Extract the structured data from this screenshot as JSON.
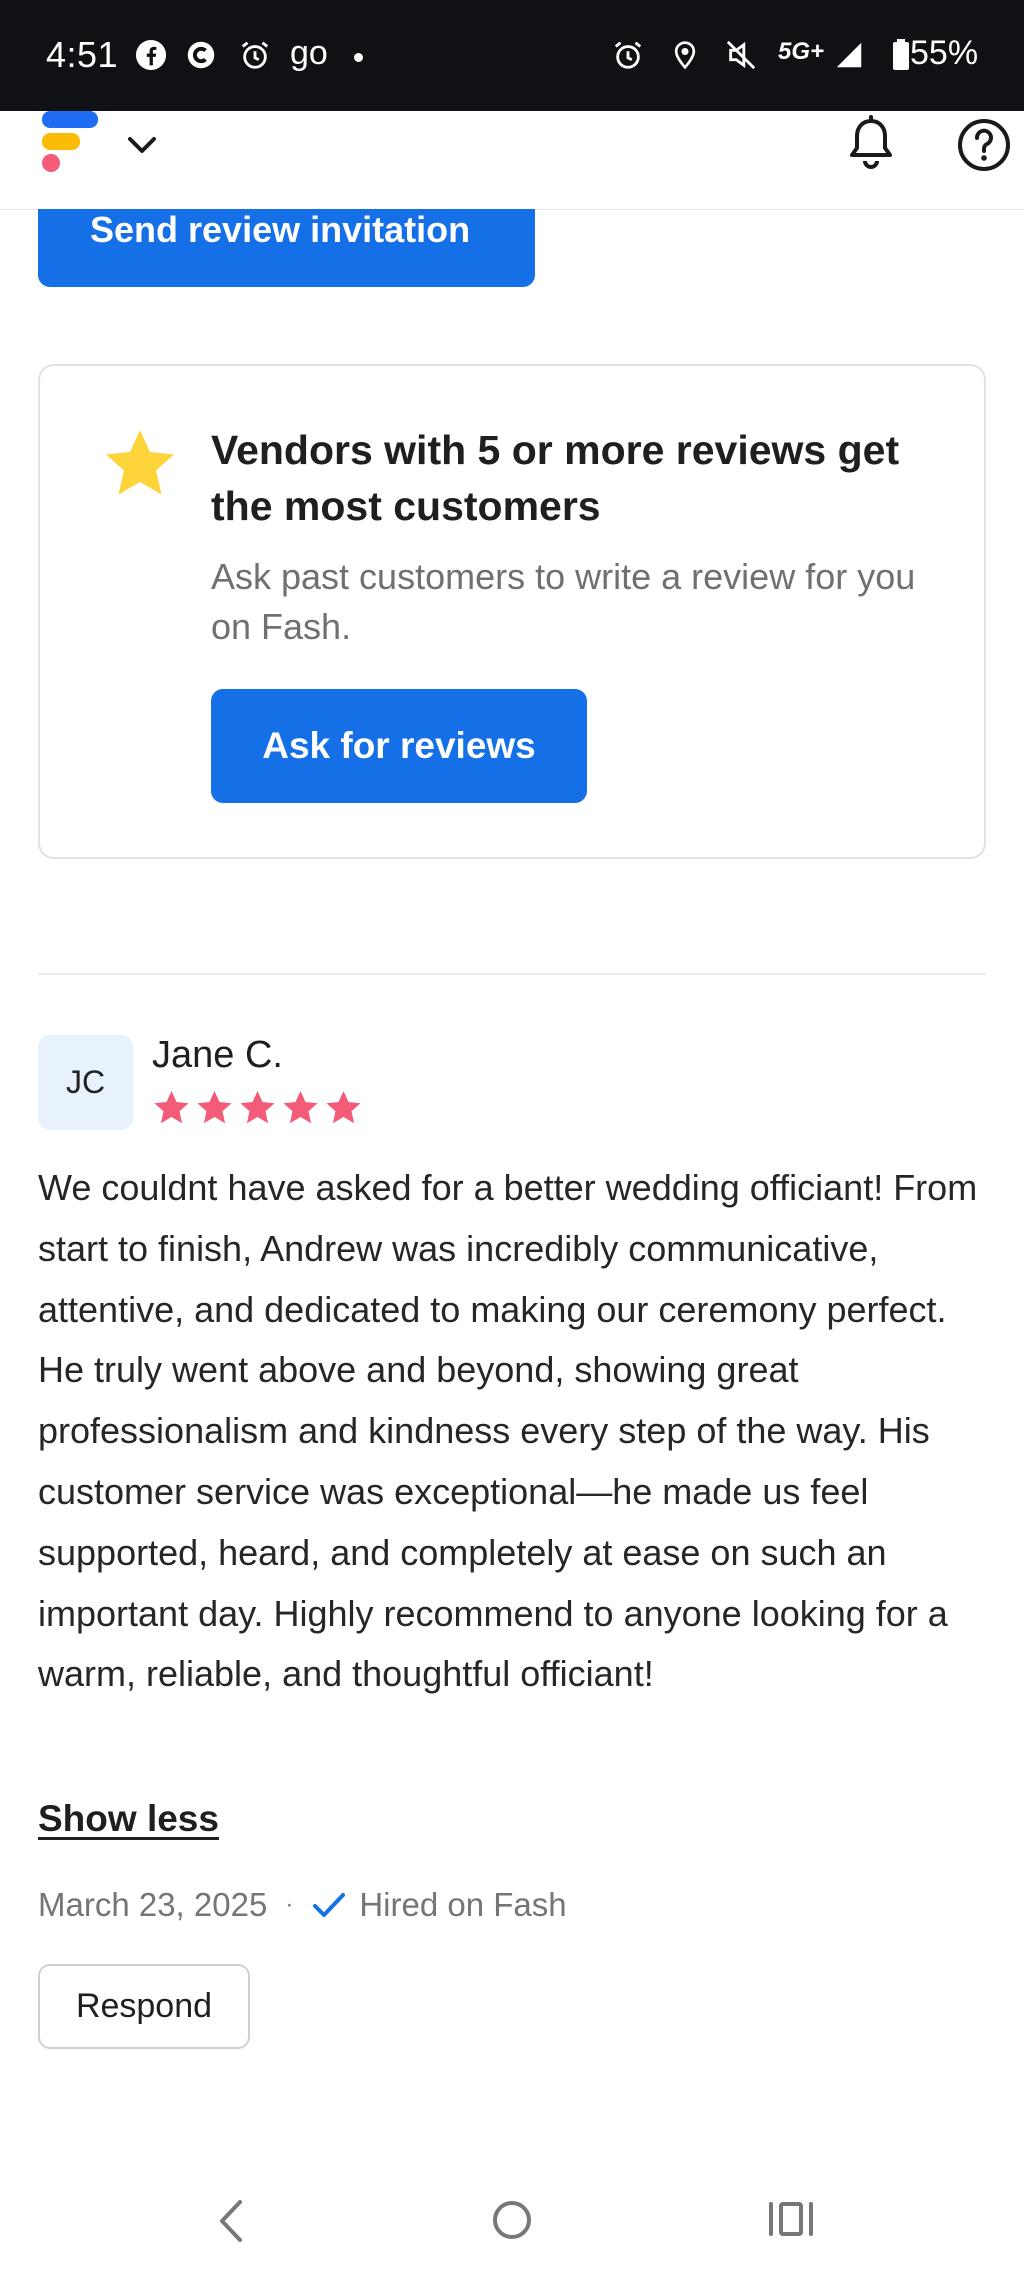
{
  "status_bar": {
    "time": "4:51",
    "network": "5G+",
    "battery": "55%",
    "left_app_text": "go",
    "left_icons": [
      "facebook-icon",
      "c-app-icon",
      "alarm-icon",
      "go-app-icon",
      "notification-dot-icon"
    ],
    "right_icons": [
      "alarm-icon",
      "location-icon",
      "mute-icon",
      "signal-icon",
      "battery-icon"
    ]
  },
  "header": {
    "icons": [
      "fash-logo-icon",
      "chevron-down-icon",
      "bell-icon",
      "help-icon"
    ]
  },
  "send_review": {
    "label": "Send review invitation"
  },
  "promo_card": {
    "title": "Vendors with 5 or more reviews get the most customers",
    "description": "Ask past customers to write a review for you on Fash.",
    "button_label": "Ask for reviews",
    "icon": "star-icon"
  },
  "review": {
    "initials": "JC",
    "name": "Jane C.",
    "rating": 5,
    "text": "We couldnt have asked for a better wedding officiant! From start to finish, Andrew was incredibly communicative, attentive, and dedicated to making our ceremony perfect. He truly went above and beyond, showing great professionalism and kindness every step of the way. His customer service was exceptional—he made us feel supported, heard, and completely at ease on such an important day. Highly recommend to anyone looking for a warm, reliable, and thoughtful officiant!",
    "show_less_label": "Show less",
    "date": "March 23, 2025",
    "separator": "·",
    "hired_label": "Hired on Fash",
    "respond_label": "Respond"
  },
  "nav_bar": {
    "icons": [
      "back-icon",
      "home-icon",
      "recent-apps-icon"
    ]
  },
  "colors": {
    "primary": "#1570e8",
    "star_rating": "#f25c78",
    "promo_star": "#fdd53a",
    "status_bar_bg": "#0f1114"
  }
}
